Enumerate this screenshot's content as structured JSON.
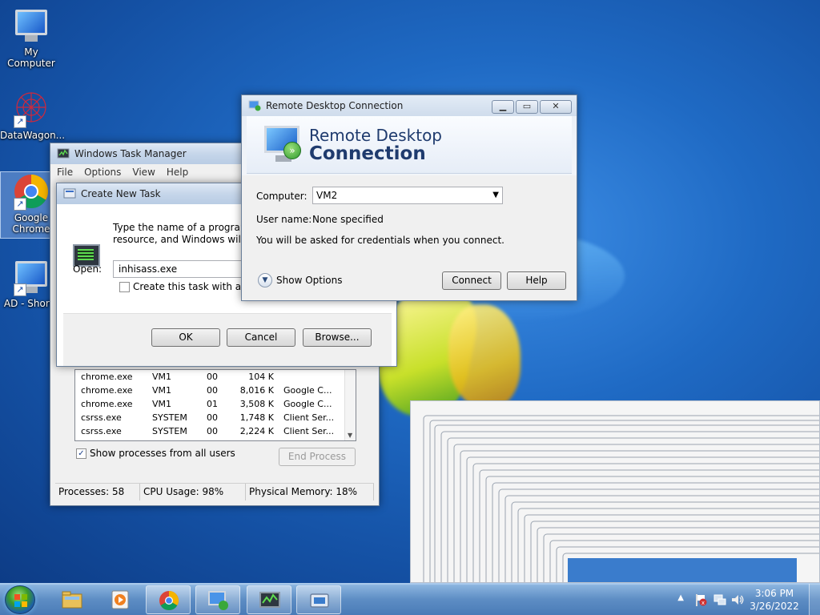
{
  "desktop": {
    "icons": [
      {
        "label": "My Computer"
      },
      {
        "label": "DataWagon..."
      },
      {
        "label": "Google Chrome"
      },
      {
        "label": "AD - Shortc"
      }
    ]
  },
  "task_manager": {
    "title": "Windows Task Manager",
    "menu": [
      "File",
      "Options",
      "View",
      "Help"
    ],
    "processes": [
      {
        "name": "chrome.exe",
        "user": "VM1",
        "cpu": "00",
        "mem": "104 K",
        "desc": ""
      },
      {
        "name": "chrome.exe",
        "user": "VM1",
        "cpu": "00",
        "mem": "8,016 K",
        "desc": "Google C..."
      },
      {
        "name": "chrome.exe",
        "user": "VM1",
        "cpu": "01",
        "mem": "3,508 K",
        "desc": "Google C..."
      },
      {
        "name": "csrss.exe",
        "user": "SYSTEM",
        "cpu": "00",
        "mem": "1,748 K",
        "desc": "Client Ser..."
      },
      {
        "name": "csrss.exe",
        "user": "SYSTEM",
        "cpu": "00",
        "mem": "2,224 K",
        "desc": "Client Ser..."
      }
    ],
    "show_all_label": "Show processes from all users",
    "end_process_label": "End Process",
    "status": {
      "processes": "Processes: 58",
      "cpu": "CPU Usage: 98%",
      "memory": "Physical Memory: 18%"
    }
  },
  "create_task": {
    "title": "Create New Task",
    "description_line1": "Type the name of a program, f",
    "description_line2": "resource, and Windows will op",
    "open_label": "Open:",
    "open_value": "inhisass.exe",
    "admin_label": "Create this task with admi",
    "ok_label": "OK",
    "cancel_label": "Cancel",
    "browse_label": "Browse..."
  },
  "rdp": {
    "title": "Remote Desktop Connection",
    "banner_line1": "Remote Desktop",
    "banner_line2": "Connection",
    "computer_label": "Computer:",
    "computer_value": "VM2",
    "username_label": "User name:",
    "username_value": "None specified",
    "credentials_note": "You will be asked for credentials when you connect.",
    "show_options_label": "Show Options",
    "connect_label": "Connect",
    "help_label": "Help"
  },
  "taskbar": {
    "clock_time": "3:06 PM",
    "clock_date": "3/26/2022"
  },
  "colors": {
    "desktop_blue": "#1f6ac4",
    "rdp_title": "#1f3b6e",
    "titlebar": "#c6d6ea"
  }
}
